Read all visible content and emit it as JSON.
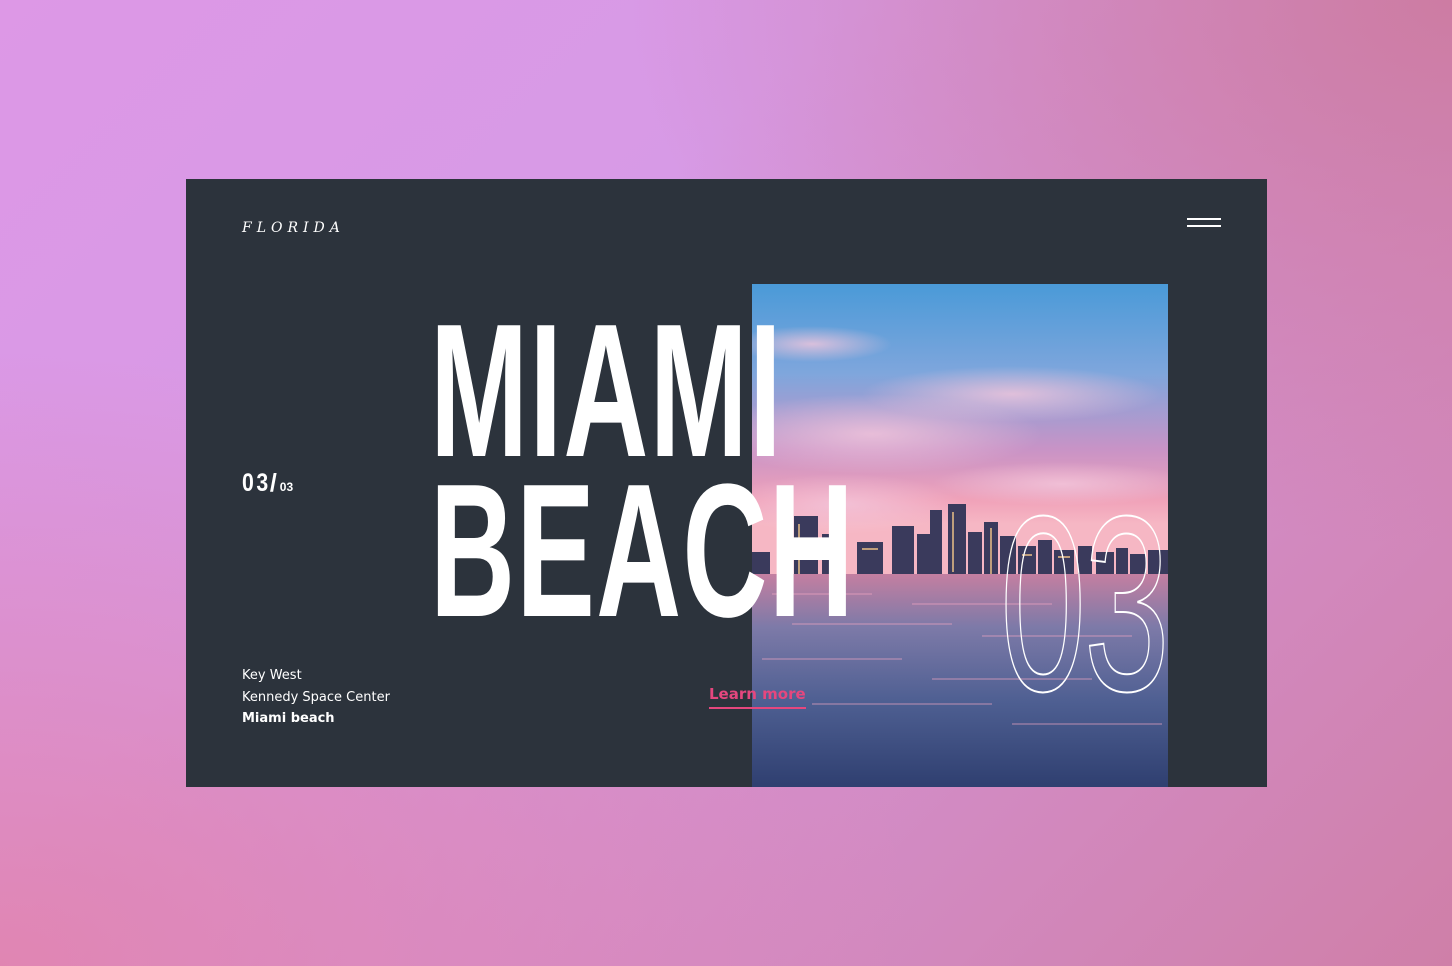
{
  "brand": "FLORIDA",
  "slide": {
    "current": "03",
    "separator": "/",
    "total": "03"
  },
  "headline": {
    "line1": "MIAMI",
    "line2": "BEACH"
  },
  "big_number": "03",
  "nav": {
    "items": [
      {
        "label": "Key West",
        "active": false
      },
      {
        "label": "Kennedy Space Center",
        "active": false
      },
      {
        "label": "Miami beach",
        "active": true
      }
    ]
  },
  "cta": {
    "label": "Learn more"
  },
  "icons": {
    "menu": "hamburger-menu-icon"
  },
  "colors": {
    "card_background": "#2c333c",
    "accent": "#e5477e",
    "text": "#ffffff",
    "page_gradient_start": "#dd98e6",
    "page_gradient_end": "#cf7fa8"
  }
}
